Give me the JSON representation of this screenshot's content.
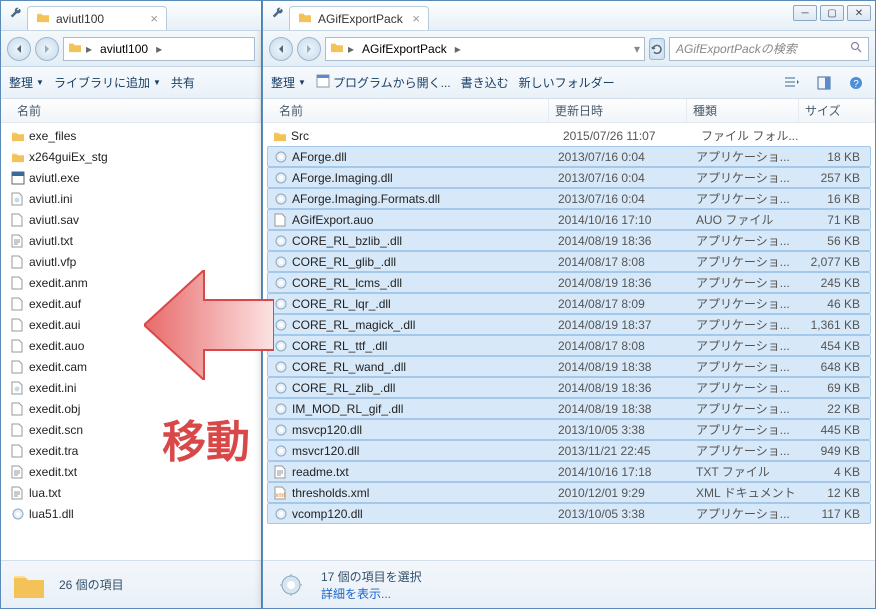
{
  "overlay": {
    "move_label": "移動"
  },
  "left": {
    "tab_title": "aviutl100",
    "breadcrumb": [
      "aviutl100"
    ],
    "toolbar": {
      "organize": "整理",
      "library": "ライブラリに追加",
      "share": "共有"
    },
    "columns": {
      "name": "名前"
    },
    "files": [
      {
        "icon": "folder",
        "name": "exe_files"
      },
      {
        "icon": "folder",
        "name": "x264guiEx_stg"
      },
      {
        "icon": "exe",
        "name": "aviutl.exe"
      },
      {
        "icon": "ini",
        "name": "aviutl.ini"
      },
      {
        "icon": "file",
        "name": "aviutl.sav"
      },
      {
        "icon": "txt",
        "name": "aviutl.txt"
      },
      {
        "icon": "file",
        "name": "aviutl.vfp"
      },
      {
        "icon": "file",
        "name": "exedit.anm"
      },
      {
        "icon": "file",
        "name": "exedit.auf"
      },
      {
        "icon": "file",
        "name": "exedit.aui"
      },
      {
        "icon": "file",
        "name": "exedit.auo"
      },
      {
        "icon": "file",
        "name": "exedit.cam"
      },
      {
        "icon": "ini",
        "name": "exedit.ini"
      },
      {
        "icon": "file",
        "name": "exedit.obj"
      },
      {
        "icon": "file",
        "name": "exedit.scn"
      },
      {
        "icon": "file",
        "name": "exedit.tra"
      },
      {
        "icon": "txt",
        "name": "exedit.txt"
      },
      {
        "icon": "txt",
        "name": "lua.txt"
      },
      {
        "icon": "dll",
        "name": "lua51.dll"
      }
    ],
    "status": {
      "count": "26 個の項目"
    }
  },
  "right": {
    "tab_title": "AGifExportPack",
    "breadcrumb": [
      "AGifExportPack"
    ],
    "search_placeholder": "AGifExportPackの検索",
    "toolbar": {
      "organize": "整理",
      "open_from": "プログラムから開く...",
      "write": "書き込む",
      "newfolder": "新しいフォルダー"
    },
    "columns": {
      "name": "名前",
      "date": "更新日時",
      "type": "種類",
      "size": "サイズ"
    },
    "files": [
      {
        "sel": false,
        "icon": "folder",
        "name": "Src",
        "date": "2015/07/26 11:07",
        "type": "ファイル フォル...",
        "size": ""
      },
      {
        "sel": true,
        "icon": "dll",
        "name": "AForge.dll",
        "date": "2013/07/16 0:04",
        "type": "アプリケーショ...",
        "size": "18 KB"
      },
      {
        "sel": true,
        "icon": "dll",
        "name": "AForge.Imaging.dll",
        "date": "2013/07/16 0:04",
        "type": "アプリケーショ...",
        "size": "257 KB"
      },
      {
        "sel": true,
        "icon": "dll",
        "name": "AForge.Imaging.Formats.dll",
        "date": "2013/07/16 0:04",
        "type": "アプリケーショ...",
        "size": "16 KB"
      },
      {
        "sel": true,
        "icon": "file",
        "name": "AGifExport.auo",
        "date": "2014/10/16 17:10",
        "type": "AUO ファイル",
        "size": "71 KB"
      },
      {
        "sel": true,
        "icon": "dll",
        "name": "CORE_RL_bzlib_.dll",
        "date": "2014/08/19 18:36",
        "type": "アプリケーショ...",
        "size": "56 KB"
      },
      {
        "sel": true,
        "icon": "dll",
        "name": "CORE_RL_glib_.dll",
        "date": "2014/08/17 8:08",
        "type": "アプリケーショ...",
        "size": "2,077 KB"
      },
      {
        "sel": true,
        "icon": "dll",
        "name": "CORE_RL_lcms_.dll",
        "date": "2014/08/19 18:36",
        "type": "アプリケーショ...",
        "size": "245 KB"
      },
      {
        "sel": true,
        "icon": "dll",
        "name": "CORE_RL_lqr_.dll",
        "date": "2014/08/17 8:09",
        "type": "アプリケーショ...",
        "size": "46 KB"
      },
      {
        "sel": true,
        "icon": "dll",
        "name": "CORE_RL_magick_.dll",
        "date": "2014/08/19 18:37",
        "type": "アプリケーショ...",
        "size": "1,361 KB"
      },
      {
        "sel": true,
        "icon": "dll",
        "name": "CORE_RL_ttf_.dll",
        "date": "2014/08/17 8:08",
        "type": "アプリケーショ...",
        "size": "454 KB"
      },
      {
        "sel": true,
        "icon": "dll",
        "name": "CORE_RL_wand_.dll",
        "date": "2014/08/19 18:38",
        "type": "アプリケーショ...",
        "size": "648 KB"
      },
      {
        "sel": true,
        "icon": "dll",
        "name": "CORE_RL_zlib_.dll",
        "date": "2014/08/19 18:36",
        "type": "アプリケーショ...",
        "size": "69 KB"
      },
      {
        "sel": true,
        "icon": "dll",
        "name": "IM_MOD_RL_gif_.dll",
        "date": "2014/08/19 18:38",
        "type": "アプリケーショ...",
        "size": "22 KB"
      },
      {
        "sel": true,
        "icon": "dll",
        "name": "msvcp120.dll",
        "date": "2013/10/05 3:38",
        "type": "アプリケーショ...",
        "size": "445 KB"
      },
      {
        "sel": true,
        "icon": "dll",
        "name": "msvcr120.dll",
        "date": "2013/11/21 22:45",
        "type": "アプリケーショ...",
        "size": "949 KB"
      },
      {
        "sel": true,
        "icon": "txt",
        "name": "readme.txt",
        "date": "2014/10/16 17:18",
        "type": "TXT ファイル",
        "size": "4 KB"
      },
      {
        "sel": true,
        "icon": "xml",
        "name": "thresholds.xml",
        "date": "2010/12/01 9:29",
        "type": "XML ドキュメント",
        "size": "12 KB"
      },
      {
        "sel": true,
        "icon": "dll",
        "name": "vcomp120.dll",
        "date": "2013/10/05 3:38",
        "type": "アプリケーショ...",
        "size": "117 KB"
      }
    ],
    "status": {
      "selected": "17 個の項目を選択",
      "detail_link": "詳細を表示..."
    }
  }
}
